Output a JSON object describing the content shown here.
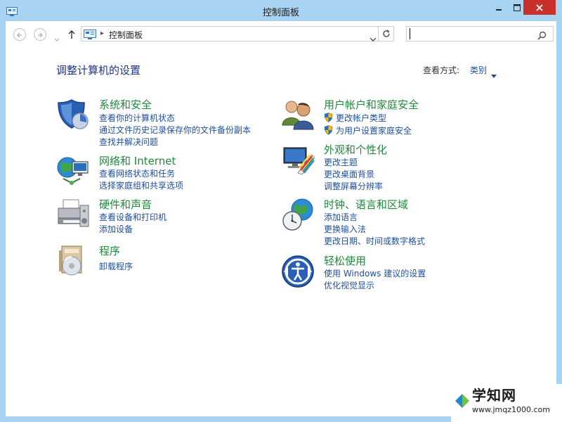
{
  "window": {
    "title": "控制面板",
    "caption_buttons": [
      "minimize-icon",
      "maximize-icon",
      "close-icon"
    ]
  },
  "navigation": {
    "back_icon": "back-arrow-icon",
    "forward_icon": "forward-arrow-icon",
    "recent_icon": "chevron-down-icon",
    "up_icon": "up-arrow-icon",
    "address": {
      "icon": "control-panel-icon",
      "separator": "▸",
      "text": "控制面板"
    },
    "refresh_icon": "refresh-icon",
    "search": {
      "placeholder": "",
      "value": "",
      "icon": "search-icon"
    }
  },
  "content": {
    "title": "调整计算机的设置",
    "view_by_label": "查看方式:",
    "view_by_value": "类别",
    "categories_left": [
      {
        "title": "系统和安全",
        "icon": "security-shield-icon",
        "links": [
          "查看你的计算机状态",
          "通过文件历史记录保存你的文件备份副本",
          "查找并解决问题"
        ]
      },
      {
        "title": "网络和 Internet",
        "icon": "network-globe-icon",
        "links": [
          "查看网络状态和任务",
          "选择家庭组和共享选项"
        ]
      },
      {
        "title": "硬件和声音",
        "icon": "printer-icon",
        "links": [
          "查看设备和打印机",
          "添加设备"
        ]
      },
      {
        "title": "程序",
        "icon": "programs-icon",
        "links": [
          "卸载程序"
        ]
      }
    ],
    "categories_right": [
      {
        "title": "用户帐户和家庭安全",
        "icon": "users-icon",
        "links": [
          "更改帐户类型",
          "为用户设置家庭安全"
        ]
      },
      {
        "title": "外观和个性化",
        "icon": "appearance-icon",
        "links": [
          "更改主题",
          "更改桌面背景",
          "调整屏幕分辨率"
        ]
      },
      {
        "title": "时钟、语言和区域",
        "icon": "clock-globe-icon",
        "links": [
          "添加语言",
          "更换输入法",
          "更改日期、时间或数字格式"
        ]
      },
      {
        "title": "轻松使用",
        "icon": "ease-of-access-icon",
        "links": [
          "使用 Windows 建议的设置",
          "优化视觉显示"
        ]
      }
    ]
  },
  "watermark": {
    "text": "学知网",
    "url": "www.jmqz1000.com"
  },
  "colors": {
    "frame": "#a9d3f2",
    "close_button": "#c7302b",
    "category_title": "#1e8a3a",
    "link": "#1e4f9c",
    "heading": "#1e3287"
  }
}
